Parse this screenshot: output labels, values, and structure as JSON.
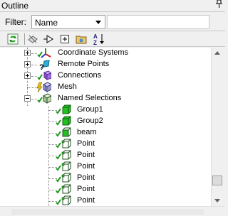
{
  "panel": {
    "title": "Outline",
    "pin_glyph": "p"
  },
  "filter": {
    "label": "Filter:",
    "value": "Name"
  },
  "toolbar": {
    "buttons": [
      {
        "name": "refresh-icon"
      },
      {
        "name": "suppress-icon"
      },
      {
        "name": "tree-filter-icon"
      },
      {
        "name": "expand-all-icon"
      },
      {
        "name": "folder-icon"
      },
      {
        "name": "sort-az-icon"
      }
    ]
  },
  "tree": {
    "items": [
      {
        "label": "Coordinate Systems",
        "icon": "coordinate-systems-icon",
        "status": "check"
      },
      {
        "label": "Remote Points",
        "icon": "remote-points-icon",
        "status": "question"
      },
      {
        "label": "Connections",
        "icon": "connections-icon",
        "status": "check"
      },
      {
        "label": "Mesh",
        "icon": "mesh-icon",
        "status": "lightning"
      },
      {
        "label": "Named Selections",
        "icon": "named-selections-icon",
        "status": "check"
      },
      {
        "label": "Group1",
        "icon": "group-green-icon",
        "status": "check"
      },
      {
        "label": "Group2",
        "icon": "group-green-icon",
        "status": "check"
      },
      {
        "label": "beam",
        "icon": "selection-body-icon",
        "status": "check"
      },
      {
        "label": "Point",
        "icon": "selection-point-icon",
        "status": "check"
      },
      {
        "label": "Point",
        "icon": "selection-point-icon",
        "status": "check"
      },
      {
        "label": "Point",
        "icon": "selection-point-icon",
        "status": "check"
      },
      {
        "label": "Point",
        "icon": "selection-point-icon",
        "status": "check"
      },
      {
        "label": "Point",
        "icon": "selection-point-icon",
        "status": "check"
      },
      {
        "label": "Point",
        "icon": "selection-point-icon",
        "status": "check"
      }
    ]
  },
  "colors": {
    "check": "#1a9a1a",
    "group_green": "#22c022",
    "lightning": "#e8c000",
    "connections": "#8a4fc8"
  }
}
